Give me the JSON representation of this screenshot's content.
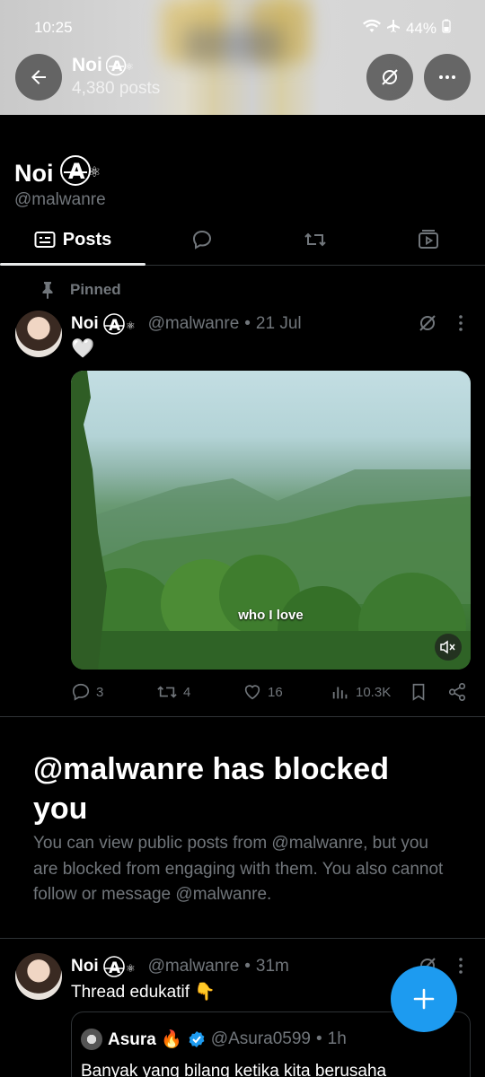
{
  "status_bar": {
    "time": "10:25",
    "battery": "44%"
  },
  "header": {
    "name": "Noi",
    "post_count": "4,380 posts"
  },
  "profile": {
    "name": "Noi",
    "handle": "@malwanre"
  },
  "tabs": [
    {
      "label": "Posts",
      "icon": "posts-icon"
    },
    {
      "label": "",
      "icon": "replies-icon"
    },
    {
      "label": "",
      "icon": "repost-icon"
    },
    {
      "label": "",
      "icon": "media-icon"
    }
  ],
  "pinned_label": "Pinned",
  "pinned_post": {
    "author": "Noi",
    "handle": "@malwanre",
    "dot": "•",
    "date": "21 Jul",
    "text": "🤍",
    "video_caption": "who I love",
    "replies": "3",
    "reposts": "4",
    "likes": "16",
    "views": "10.3K"
  },
  "blocked": {
    "title": "@malwanre has blocked you",
    "description": "You can view public posts from @malwanre, but you are blocked from engaging with them. You also cannot follow or message @malwanre."
  },
  "second_post": {
    "author": "Noi",
    "handle": "@malwanre",
    "dot": "•",
    "time": "31m",
    "text": "Thread edukatif 👇",
    "quote": {
      "author": "Asura 🔥",
      "handle": "@Asura0599",
      "dot": "•",
      "time": "1h",
      "text": "Banyak yang bilang ketika kita berusaha"
    }
  },
  "colors": {
    "accent": "#1d9bf0",
    "muted": "#71767b",
    "background": "#000000"
  }
}
